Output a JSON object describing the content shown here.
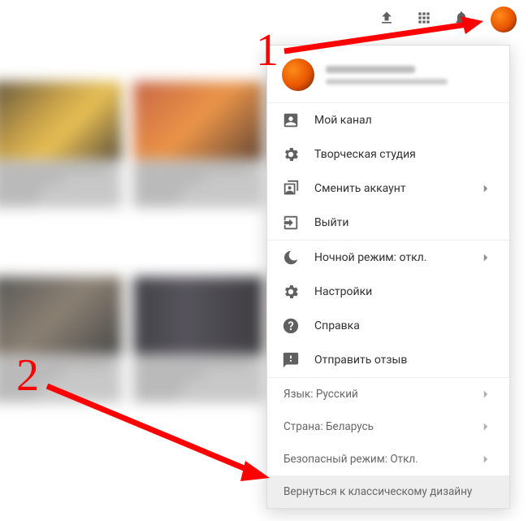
{
  "annotations": {
    "step1": "1",
    "step2": "2"
  },
  "menu": {
    "my_channel": "Мой канал",
    "creator_studio": "Творческая студия",
    "switch_account": "Сменить аккаунт",
    "sign_out": "Выйти",
    "night_mode": "Ночной режим: откл.",
    "settings": "Настройки",
    "help": "Справка",
    "feedback": "Отправить отзыв",
    "language": "Язык: Русский",
    "country": "Страна: Беларусь",
    "safe_mode": "Безопасный режим: Откл.",
    "classic": "Вернуться к классическому дизайну"
  }
}
